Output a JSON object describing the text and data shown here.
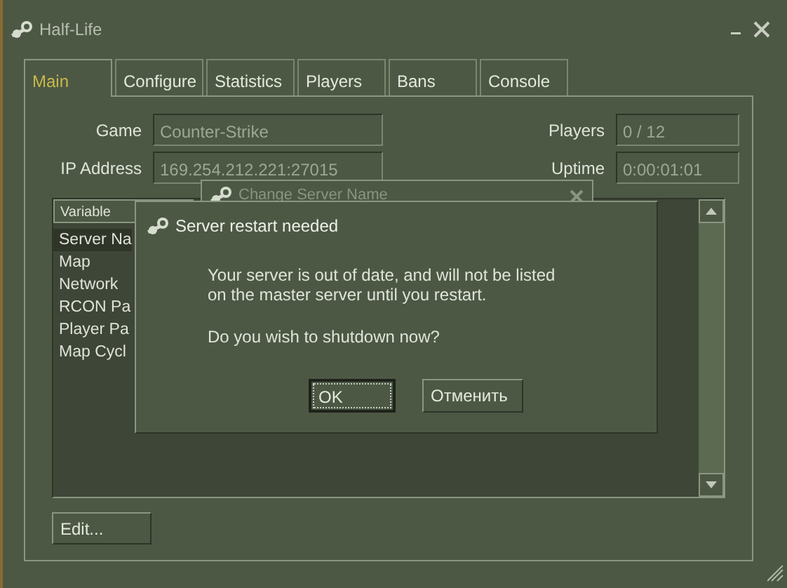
{
  "window": {
    "title": "Half-Life"
  },
  "tabs": [
    {
      "label": "Main",
      "selected": true
    },
    {
      "label": "Configure",
      "selected": false
    },
    {
      "label": "Statistics",
      "selected": false
    },
    {
      "label": "Players",
      "selected": false
    },
    {
      "label": "Bans",
      "selected": false
    },
    {
      "label": "Console",
      "selected": false
    }
  ],
  "fields_left": [
    {
      "label": "Game",
      "value": "Counter-Strike"
    },
    {
      "label": "IP Address",
      "value": "169.254.212.221:27015"
    }
  ],
  "fields_right": [
    {
      "label": "Players",
      "value": "0 / 12"
    },
    {
      "label": "Uptime",
      "value": "0:00:01:01"
    }
  ],
  "variables": {
    "columns": [
      "Variable"
    ],
    "rows": [
      {
        "name": "Server Na",
        "selected": true
      },
      {
        "name": "Map",
        "selected": false
      },
      {
        "name": "Network",
        "selected": false
      },
      {
        "name": "RCON Pa",
        "selected": false
      },
      {
        "name": "Player Pa",
        "selected": false
      },
      {
        "name": "Map Cycl",
        "selected": false
      }
    ]
  },
  "edit_button": "Edit...",
  "background_dialog": {
    "title": "Change Server Name"
  },
  "dialog": {
    "title": "Server restart needed",
    "message": "Your server is out of date, and will not be listed\non the master server until you restart.",
    "question": "Do you wish to shutdown now?",
    "buttons": [
      {
        "label": "OK",
        "default": true
      },
      {
        "label": "Отменить",
        "default": false
      }
    ]
  }
}
